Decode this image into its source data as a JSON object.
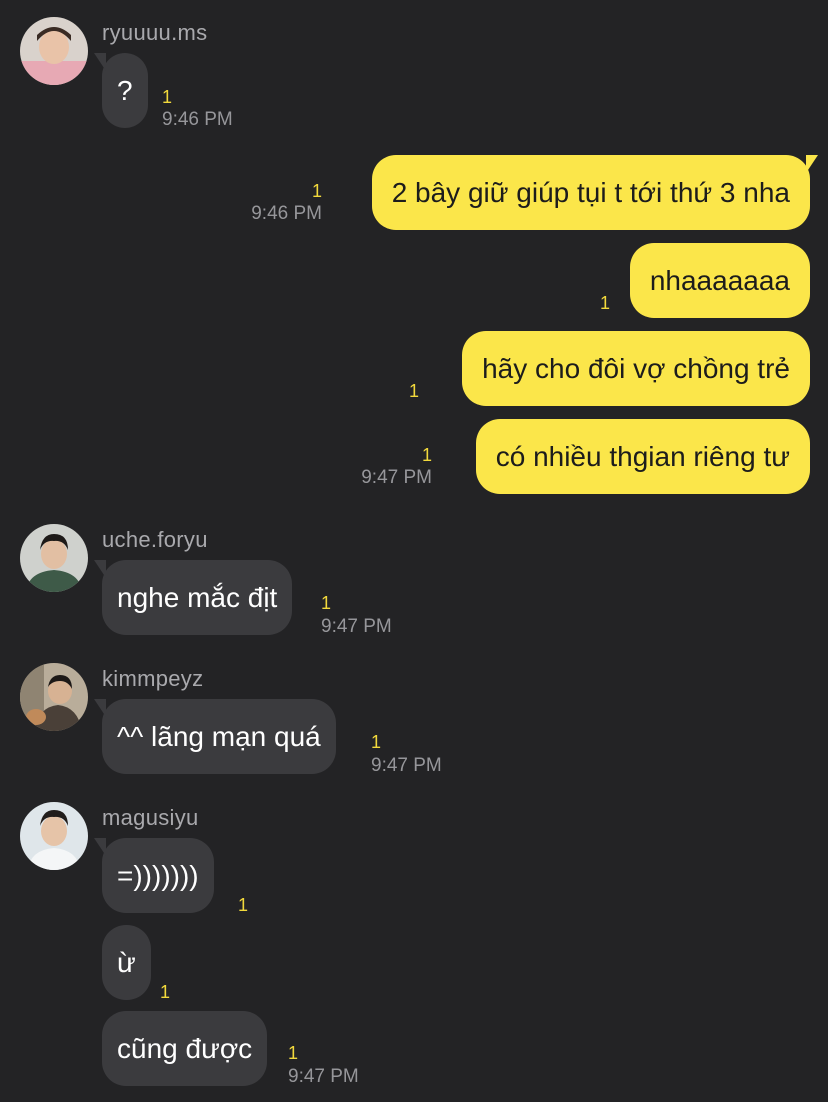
{
  "colors": {
    "background": "#232325",
    "incoming_bubble": "#3b3b3e",
    "outgoing_bubble": "#fbe64a",
    "unread_count": "#f2d93c",
    "meta_text": "#96969a"
  },
  "groups": [
    {
      "sender": "ryuuuu.ms",
      "avatar": "avatar-photo",
      "messages": [
        {
          "text": "?",
          "unread": "1",
          "time": "9:46 PM"
        }
      ]
    },
    {
      "sender": "me",
      "messages": [
        {
          "text": "2 bây giữ giúp tụi t tới thứ 3 nha",
          "unread": "1",
          "time": "9:46 PM"
        },
        {
          "text": "nhaaaaaaa",
          "unread": "1"
        },
        {
          "text": "hãy cho đôi vợ chồng trẻ",
          "unread": "1"
        },
        {
          "text": "có nhiều thgian riêng tư",
          "unread": "1",
          "time": "9:47 PM"
        }
      ]
    },
    {
      "sender": "uche.foryu",
      "avatar": "avatar-photo",
      "messages": [
        {
          "text": "nghe mắc địt",
          "unread": "1",
          "time": "9:47 PM"
        }
      ]
    },
    {
      "sender": "kimmpeyz",
      "avatar": "avatar-photo",
      "messages": [
        {
          "text": "^^ lãng mạn quá",
          "unread": "1",
          "time": "9:47 PM"
        }
      ]
    },
    {
      "sender": "magusiyu",
      "avatar": "avatar-photo",
      "messages": [
        {
          "text": "=)))))))",
          "unread": "1"
        },
        {
          "text": "ừ",
          "unread": "1"
        },
        {
          "text": "cũng được",
          "unread": "1",
          "time": "9:47 PM"
        }
      ]
    }
  ]
}
